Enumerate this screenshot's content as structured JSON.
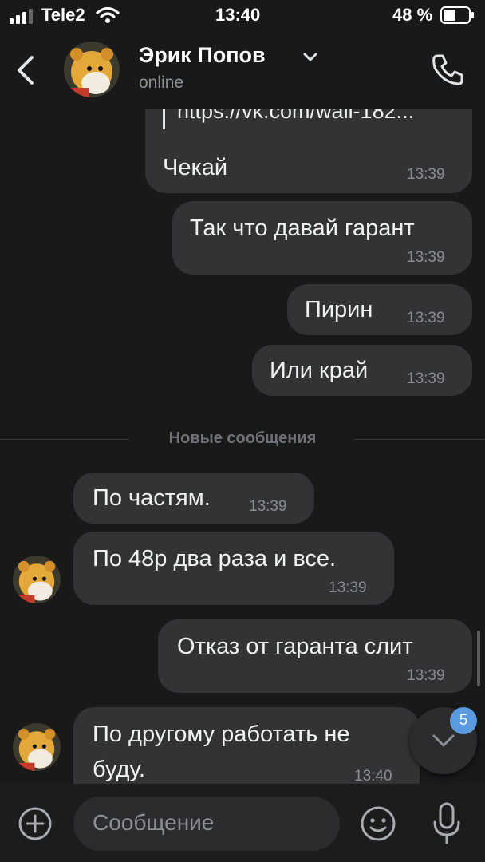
{
  "status_bar": {
    "carrier": "Tele2",
    "time": "13:40",
    "battery": "48 %"
  },
  "header": {
    "name": "Эрик Попов",
    "status": "online"
  },
  "link_preview": {
    "url": "https://vk.com/wall-182..."
  },
  "messages": [
    {
      "text": "Чекай",
      "time": "13:39",
      "side": "in"
    },
    {
      "text": "Так что давай гарант",
      "time": "13:39",
      "side": "out"
    },
    {
      "text": "Пирин",
      "time": "13:39",
      "side": "out"
    },
    {
      "text": "Или край",
      "time": "13:39",
      "side": "out"
    },
    {
      "text": "По частям.",
      "time": "13:39",
      "side": "in"
    },
    {
      "text": "По 48р два раза и все.",
      "time": "13:39",
      "side": "in"
    },
    {
      "text": "Отказ от гаранта слит",
      "time": "13:39",
      "side": "out"
    },
    {
      "text_line1": "По другому работать не",
      "text_line2": "буду.",
      "time": "13:40",
      "side": "in"
    }
  ],
  "divider": {
    "label": "Новые сообщения"
  },
  "scroll_down": {
    "badge": "5",
    "icon": "chevron-down-icon"
  },
  "composer": {
    "placeholder": "Сообщение",
    "icons": [
      "plus-icon",
      "emoji-icon",
      "microphone-icon"
    ]
  },
  "colors": {
    "background": "#19191a",
    "bubble": "#333335",
    "badge": "#5a9bdf"
  }
}
